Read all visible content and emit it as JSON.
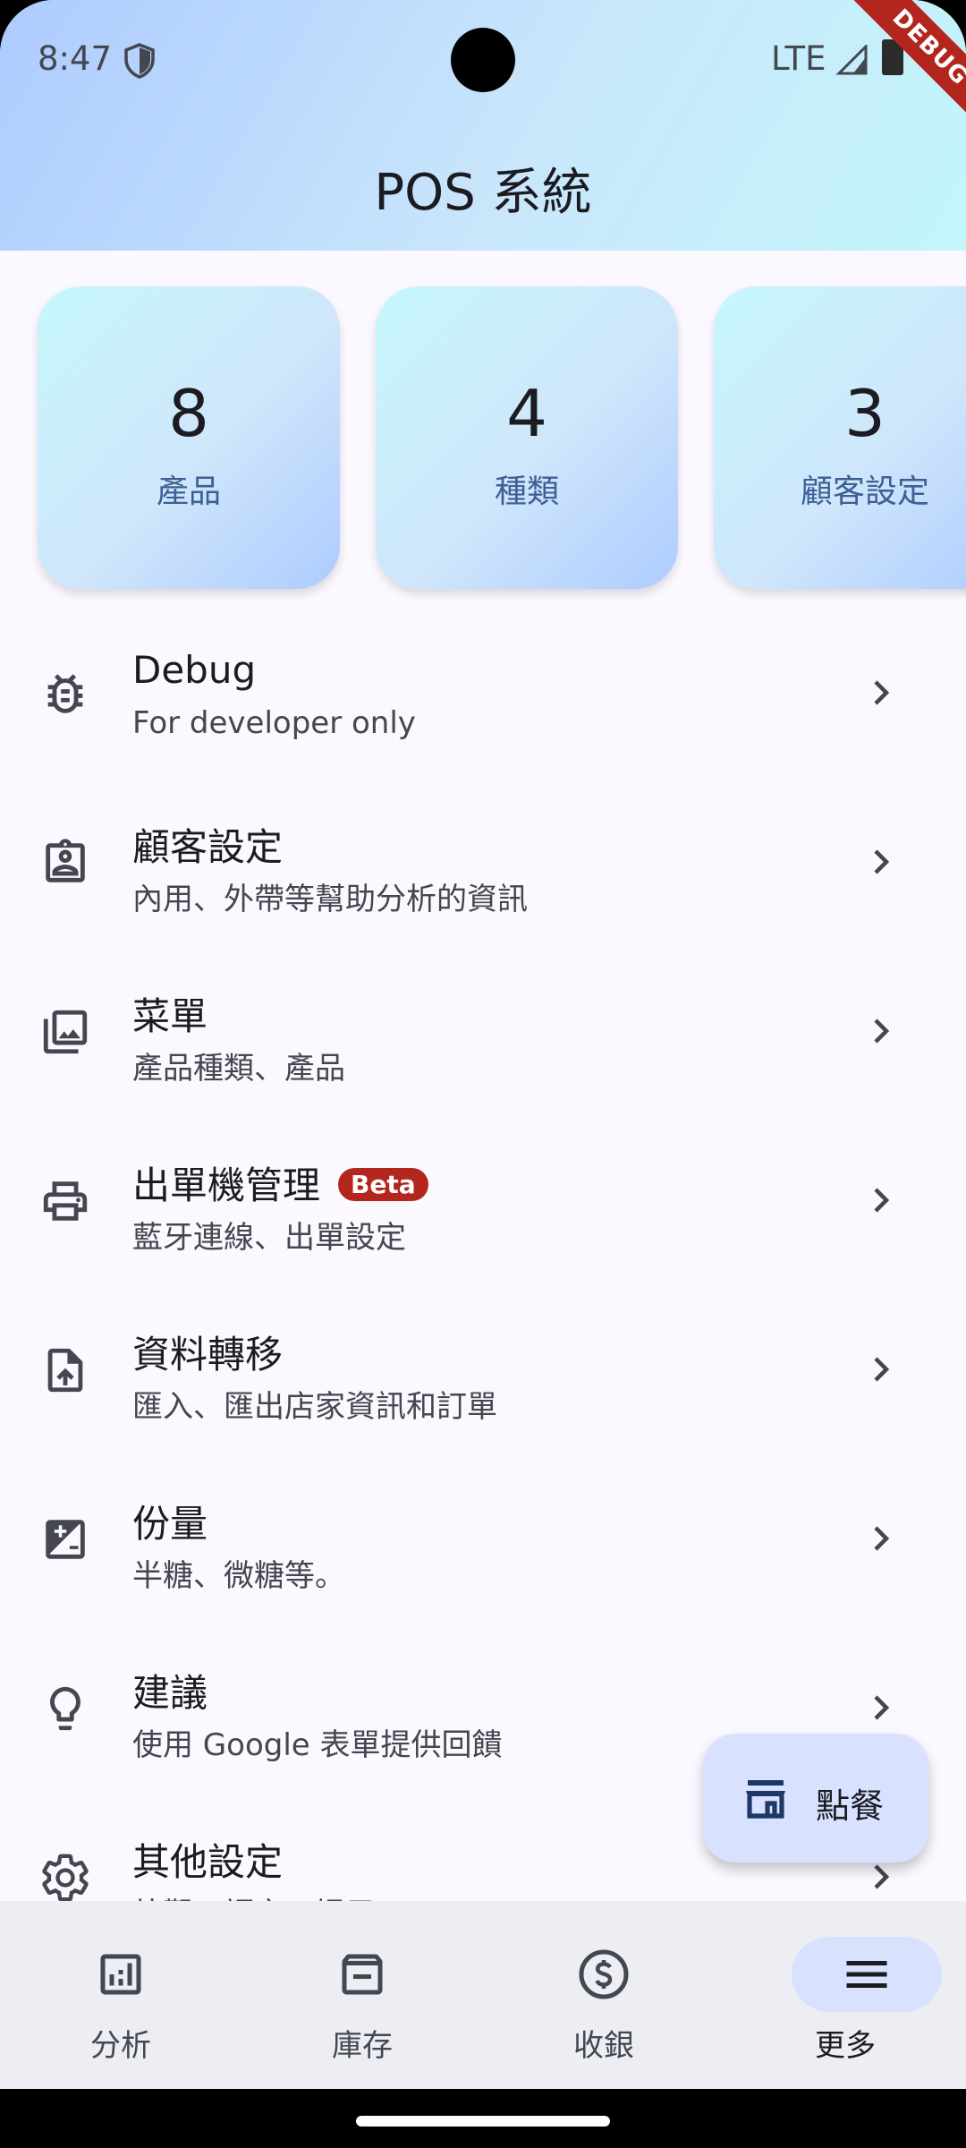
{
  "status_bar": {
    "time": "8:47",
    "network": "LTE",
    "debug_banner": "DEBUG"
  },
  "app_bar": {
    "title": "POS 系統"
  },
  "stat_cards": [
    {
      "value": "8",
      "label": "產品"
    },
    {
      "value": "4",
      "label": "種類"
    },
    {
      "value": "3",
      "label": "顧客設定"
    }
  ],
  "menu": [
    {
      "icon": "bug-icon",
      "title": "Debug",
      "subtitle": "For developer only"
    },
    {
      "icon": "contact-badge-icon",
      "title": "顧客設定",
      "subtitle": "內用、外帶等幫助分析的資訊"
    },
    {
      "icon": "photo-library-icon",
      "title": "菜單",
      "subtitle": "產品種類、產品"
    },
    {
      "icon": "printer-icon",
      "title": "出單機管理",
      "badge": "Beta",
      "subtitle": "藍牙連線、出單設定"
    },
    {
      "icon": "file-upload-icon",
      "title": "資料轉移",
      "subtitle": "匯入、匯出店家資訊和訂單"
    },
    {
      "icon": "quantity-icon",
      "title": "份量",
      "subtitle": "半糖、微糖等。"
    },
    {
      "icon": "lightbulb-icon",
      "title": "建議",
      "subtitle": "使用 Google 表單提供回饋"
    },
    {
      "icon": "gear-icon",
      "title": "其他設定",
      "subtitle": "外觀、語言、提示"
    }
  ],
  "fab": {
    "icon": "storefront-icon",
    "label": "點餐"
  },
  "bottom_nav": [
    {
      "icon": "analytics-icon",
      "label": "分析"
    },
    {
      "icon": "archive-icon",
      "label": "庫存"
    },
    {
      "icon": "dollar-icon",
      "label": "收銀"
    },
    {
      "icon": "menu-icon",
      "label": "更多",
      "selected": true
    }
  ],
  "colors": {
    "accent": "#3e5f95",
    "badge": "#b3261e",
    "selected_pill": "#d8e2ff"
  }
}
